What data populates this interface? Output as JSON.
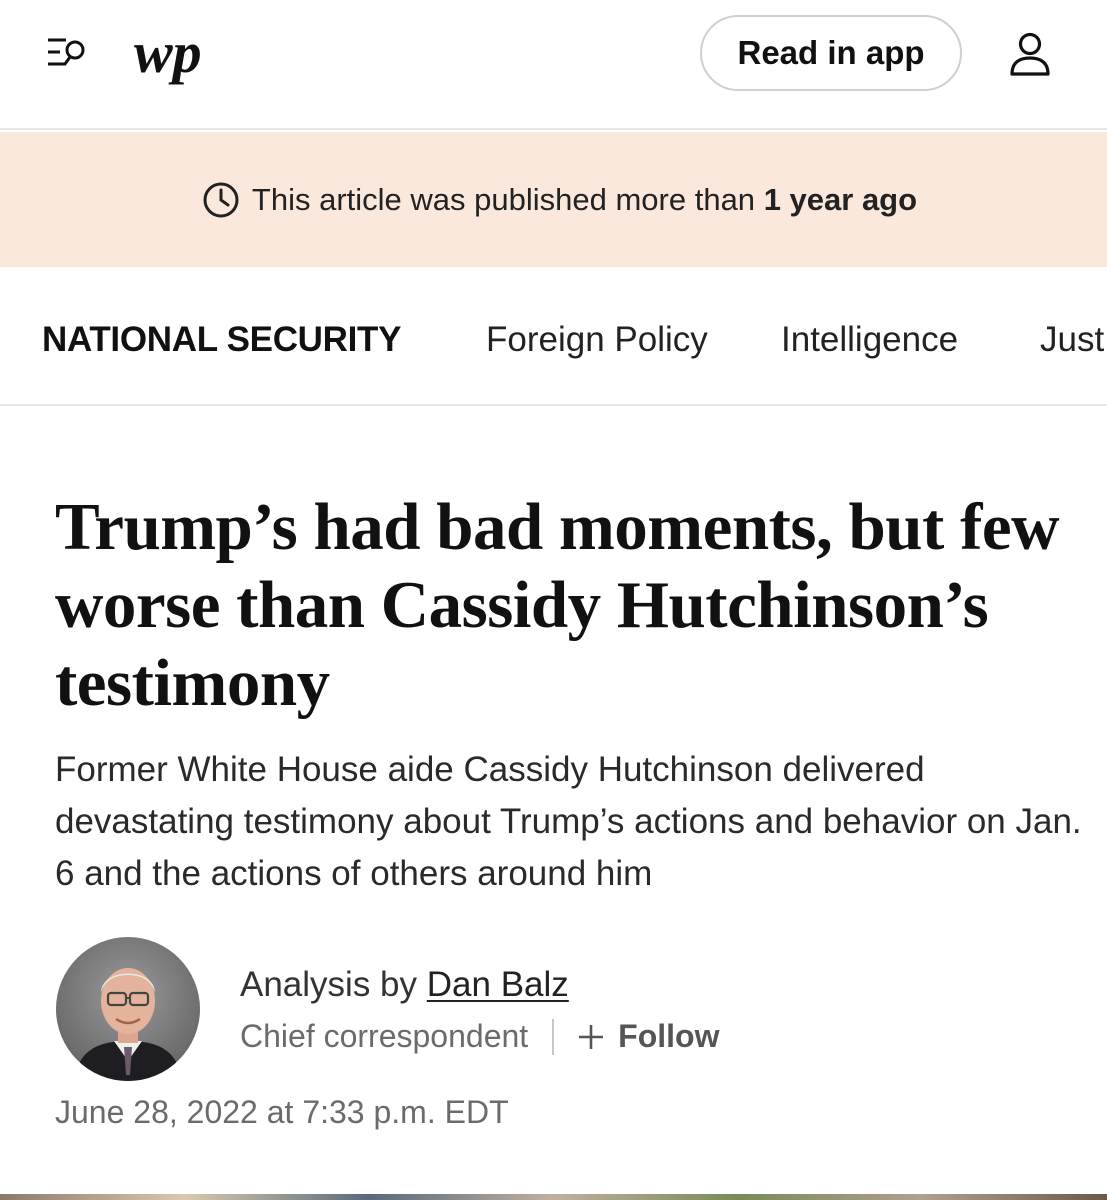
{
  "header": {
    "logo_text": "wp",
    "read_in_app_label": "Read in app",
    "icons": [
      "menu-search-icon",
      "user-icon"
    ]
  },
  "banner": {
    "text_prefix": "This article was published more than",
    "text_bold": "1 year ago",
    "icon": "clock-icon",
    "background_color": "#fbe8dd"
  },
  "subnav": {
    "section": "NATIONAL SECURITY",
    "links": [
      "Foreign Policy",
      "Intelligence",
      "Just"
    ]
  },
  "article": {
    "headline": "Trump’s had bad moments, but few worse than Cassidy Hutchinson’s testimony",
    "dek": "Former White House aide Cassidy Hutchinson delivered devastating testimony about Trump’s actions and behavior on Jan. 6 and the actions of others around him",
    "byline_prefix": "Analysis by",
    "author": "Dan Balz",
    "author_role": "Chief correspondent",
    "follow_label": "Follow",
    "timestamp": "June 28, 2022 at 7:33 p.m. EDT"
  }
}
